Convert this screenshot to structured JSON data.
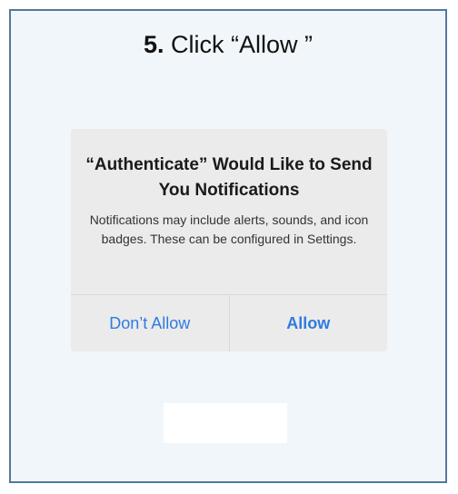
{
  "instruction": {
    "step_number": "5.",
    "step_text": " Click “Allow ”"
  },
  "alert": {
    "title": "“Authenticate” Would Like to Send You Notifications",
    "message": "Notifications may include alerts, sounds, and icon badges. These can be configured in Settings.",
    "buttons": {
      "dont_allow": "Don’t Allow",
      "allow": "Allow"
    }
  },
  "colors": {
    "frame_border": "#53789d",
    "background": "#f1f6fa",
    "alert_background": "#ebebeb",
    "button_text": "#2f7be0"
  }
}
